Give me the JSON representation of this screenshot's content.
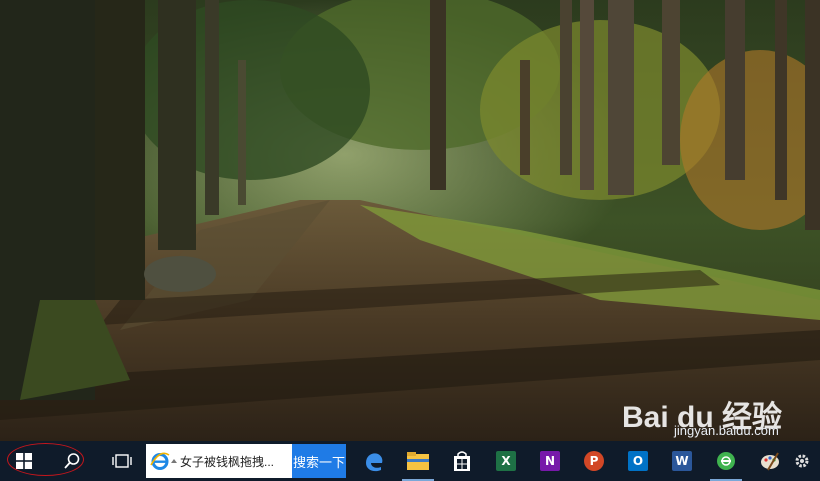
{
  "taskbar": {
    "ie_search": {
      "query_text": "女子被钱枫拖拽...",
      "button_label": "搜索一下"
    },
    "apps": [
      {
        "name": "edge-icon"
      },
      {
        "name": "file-explorer-icon"
      },
      {
        "name": "store-icon"
      },
      {
        "name": "excel-icon",
        "letter": "X",
        "color": "#1e7145"
      },
      {
        "name": "onenote-icon",
        "letter": "N",
        "color": "#7719aa"
      },
      {
        "name": "powerpoint-icon",
        "letter": "P",
        "color": "#d24726"
      },
      {
        "name": "outlook-icon",
        "letter": "O",
        "color": "#0072c6"
      },
      {
        "name": "word-icon",
        "letter": "W",
        "color": "#2b579a"
      },
      {
        "name": "green-browser-icon",
        "color": "#3fb34f"
      },
      {
        "name": "paint-icon"
      },
      {
        "name": "settings-icon"
      }
    ]
  },
  "watermark": {
    "brand": "Bai du 经验",
    "url": "jingyan.baidu.com"
  },
  "colors": {
    "taskbar_bg": "#0f1b2a",
    "search_button": "#1f7be6",
    "highlight": "#c4161c"
  }
}
